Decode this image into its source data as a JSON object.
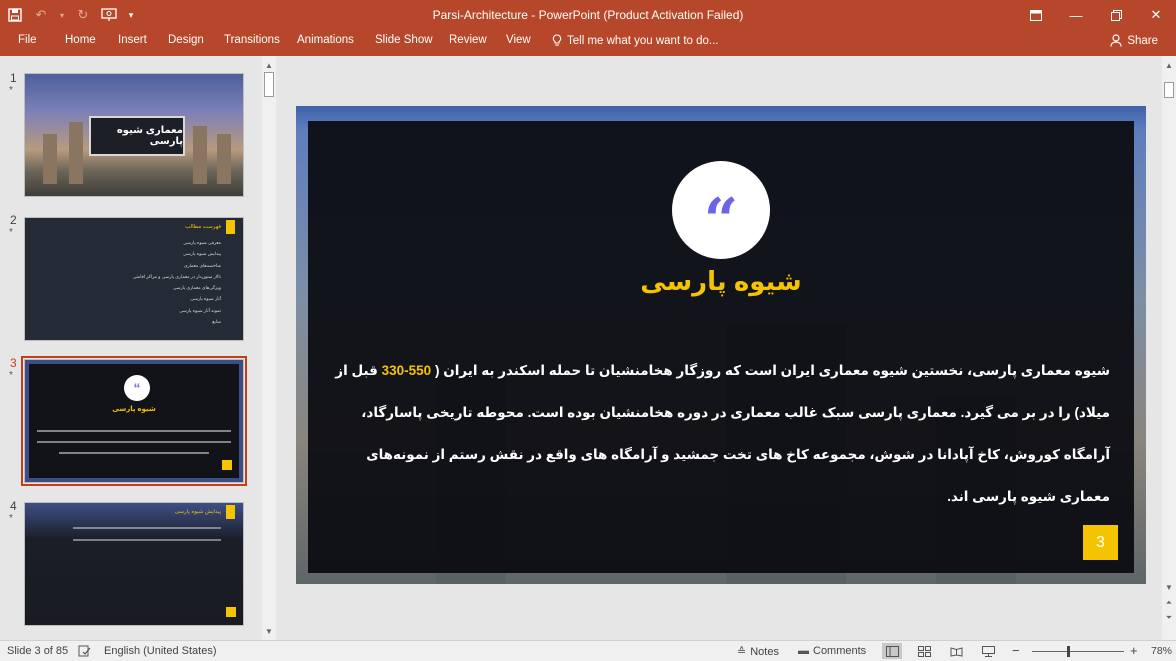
{
  "app": {
    "window_title": "Parsi-Architecture - PowerPoint (Product Activation Failed)"
  },
  "quick_access": {
    "save_icon": "save-icon",
    "undo_icon": "undo-icon",
    "redo_icon": "redo-icon",
    "present_icon": "present-from-start-icon",
    "customize_icon": "customize-qat-icon"
  },
  "ribbon": {
    "tabs": [
      "File",
      "Home",
      "Insert",
      "Design",
      "Transitions",
      "Animations",
      "Slide Show",
      "Review",
      "View"
    ],
    "tell_me": "Tell me what you want to do...",
    "share": "Share"
  },
  "thumbnails": {
    "items": [
      {
        "number": "1",
        "star": "*",
        "title": "معماری شیوه پارسی"
      },
      {
        "number": "2",
        "star": "*",
        "title": "فهرست مطالب",
        "list": [
          "معرفی شیوه پارسی",
          "پیدایش شیوه پارسی",
          "شاخصه‌های معماری",
          "تالار ستون‌دار در معماری پارسی و مراکز اقامتی",
          "ویژگی‌های معماری پارسی",
          "آثار شیوه پارسی",
          "نمونه آثار شیوه پارسی",
          "منابع"
        ]
      },
      {
        "number": "3",
        "star": "*",
        "title": "شیوه پارسی"
      },
      {
        "number": "4",
        "star": "*",
        "title": "پیدایش شیوه پارسی"
      }
    ],
    "selected_index": 2
  },
  "slide": {
    "title": "شیوه پارسی",
    "body_before": "شیوه معماری پارسی، نخستین شیوه معماری ایران است که روزگار هخامنشیان تا حمله اسکندر به ایران (",
    "body_highlight": " 550-330 ",
    "body_after": "قبل از میلاد) را در بر می گیرد. معماری پارسی سبک غالب معماری در دوره هخامنشیان بوده است. محوطه تاریخی پاسارگاد، آرامگاه کوروش، کاخ آپادانا در شوش، مجموعه کاخ های تخت جمشید و آرامگاه های واقع در نقش رستم از نمونه‌های معماری شیوه پارسی اند.",
    "number": "3",
    "accent_color": "#f5c400",
    "quote_color": "#6c63e6"
  },
  "status": {
    "slide_info": "Slide 3 of 85",
    "language": "English (United States)",
    "notes": "Notes",
    "comments": "Comments",
    "zoom": "78%",
    "zoom_fraction": 0.78
  }
}
